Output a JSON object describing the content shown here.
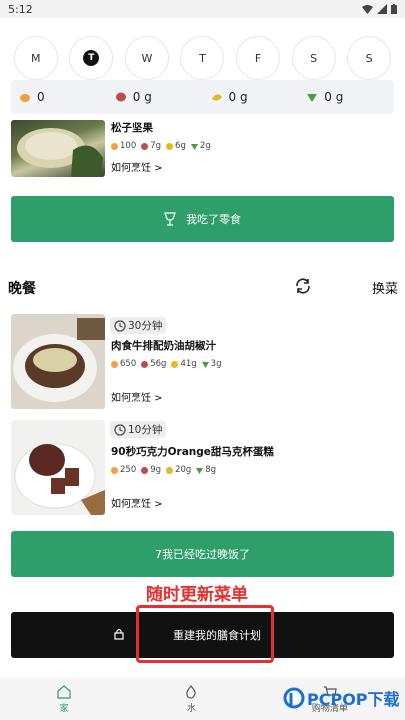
{
  "status": {
    "time": "5:12"
  },
  "days": [
    "M",
    "T",
    "W",
    "T",
    "F",
    "S",
    "S"
  ],
  "macros": [
    {
      "icon": "calorie-icon",
      "value": "0",
      "color": "#f0a040"
    },
    {
      "icon": "protein-icon",
      "value": "0 g",
      "color": "#c24a4a"
    },
    {
      "icon": "carb-icon",
      "value": "0 g",
      "color": "#e8b820"
    },
    {
      "icon": "fat-icon",
      "value": "0 g",
      "color": "#4a9e3a"
    }
  ],
  "snack": {
    "name": "松子坚果",
    "nutrition": [
      "100",
      "7g",
      "6g",
      "2g"
    ],
    "how": "如何烹饪 >",
    "button": "我吃了零食"
  },
  "dinner": {
    "title": "晚餐",
    "swap": "换菜",
    "items": [
      {
        "time": "30分钟",
        "name": "肉食牛排配奶油胡椒汁",
        "nutrition": [
          "650",
          "56g",
          "41g",
          "3g"
        ],
        "how": "如何烹饪 >"
      },
      {
        "time": "10分钟",
        "name": "90秒巧克力Orange甜马克杯蛋糕",
        "nutrition": [
          "250",
          "9g",
          "20g",
          "8g"
        ],
        "how": "如何烹饪 >"
      }
    ],
    "button": "7我已经吃过晚饭了"
  },
  "annotation": "随时更新菜单",
  "rebuild_button": "重建我的膳食计划",
  "tabs": [
    {
      "label": "家"
    },
    {
      "label": "水"
    },
    {
      "label": "购物清单"
    }
  ],
  "watermark": "PCPOP下载",
  "colors": {
    "accent": "#2e9e6a",
    "annotation": "#e53030"
  }
}
